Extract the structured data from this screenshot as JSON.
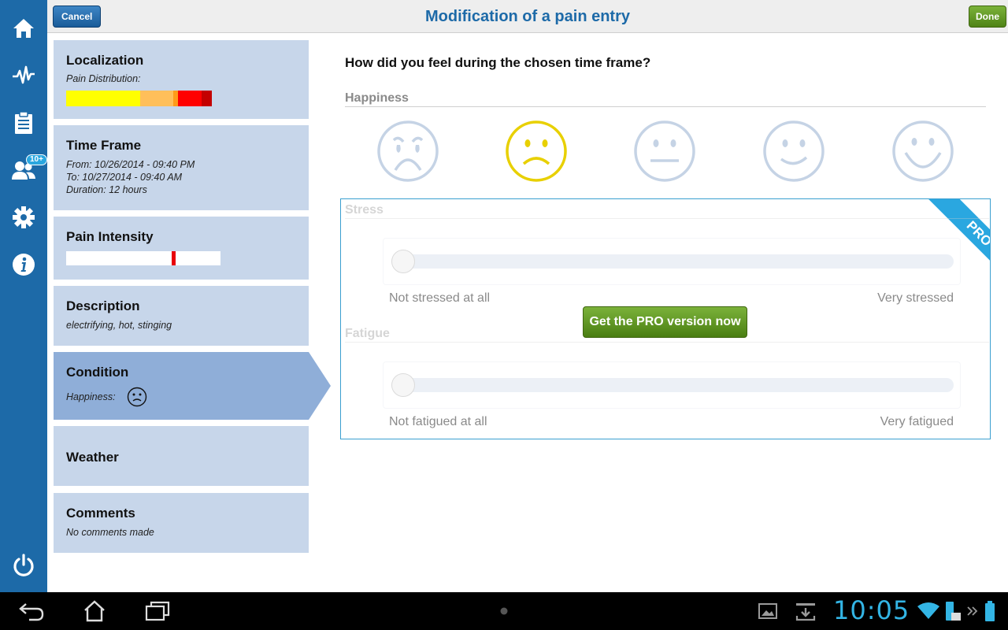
{
  "topbar": {
    "title": "Modification of a pain entry",
    "cancel_label": "Cancel",
    "done_label": "Done"
  },
  "nav": {
    "badge": "10+"
  },
  "cards": {
    "localization": {
      "title": "Localization",
      "sub": "Pain Distribution:",
      "distribution": [
        {
          "color": "#ffff00",
          "fraction": 0.51
        },
        {
          "color": "#ffbf5a",
          "fraction": 0.23
        },
        {
          "color": "#ff9b1a",
          "fraction": 0.03
        },
        {
          "color": "#ff0000",
          "fraction": 0.16
        },
        {
          "color": "#c40000",
          "fraction": 0.07
        }
      ]
    },
    "timeframe": {
      "title": "Time Frame",
      "from": "From: 10/26/2014 - 09:40 PM",
      "to": "To: 10/27/2014 - 09:40 AM",
      "duration": "Duration: 12 hours"
    },
    "intensity": {
      "title": "Pain Intensity",
      "level": 0.7
    },
    "description": {
      "title": "Description",
      "sub": "electrifying, hot, stinging"
    },
    "condition": {
      "title": "Condition",
      "sub": "Happiness:"
    },
    "weather": {
      "title": "Weather"
    },
    "comments": {
      "title": "Comments",
      "sub": "No comments made"
    }
  },
  "main": {
    "question": "How did you feel during the chosen time frame?",
    "happiness_label": "Happiness",
    "selected_face": 1,
    "stress": {
      "label": "Stress",
      "min_label": "Not stressed at all",
      "max_label": "Very stressed"
    },
    "fatigue": {
      "label": "Fatigue",
      "min_label": "Not fatigued at all",
      "max_label": "Very fatigued"
    },
    "pro_ribbon": "PRO",
    "pro_button": "Get the PRO version now"
  },
  "system": {
    "clock": "10:05"
  },
  "colors": {
    "brand_blue": "#1d6aa8",
    "accent_green": "#5b9320",
    "face_selected": "#e8d000",
    "face_inactive": "#c5d3e5"
  }
}
